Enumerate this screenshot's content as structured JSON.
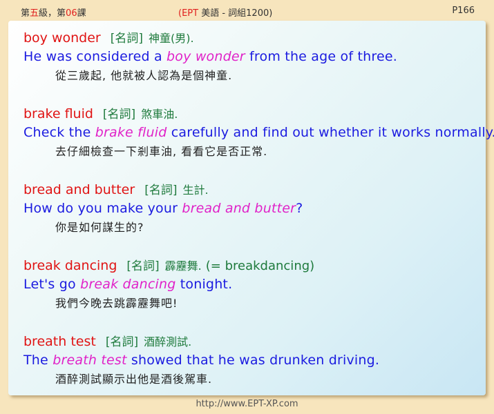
{
  "header": {
    "left_prefix": "第",
    "left_grade": "五",
    "left_mid": "級，第",
    "left_lesson": "06",
    "left_suffix": "課",
    "center_open": "(",
    "center_ept": "EPT",
    "center_rest": " 美語 - 詞組1200)",
    "page": "P166"
  },
  "entries": [
    {
      "term": "boy wonder",
      "pos": "[名詞]",
      "meaning": "神童(男).",
      "note": "",
      "sentence_before": "He was considered a ",
      "sentence_highlight": "boy wonder",
      "sentence_after": " from the age of three.",
      "translation": "從三歲起, 他就被人認為是個神童."
    },
    {
      "term": "brake fluid",
      "pos": "[名詞]",
      "meaning": "煞車油.",
      "note": "",
      "sentence_before": "Check the ",
      "sentence_highlight": "brake fluid",
      "sentence_after": " carefully and find out whether it works normally.",
      "translation": "去仔細檢查一下剎車油, 看看它是否正常."
    },
    {
      "term": "bread and butter",
      "pos": "[名詞]",
      "meaning": "生計.",
      "note": "",
      "sentence_before": "How do you make your ",
      "sentence_highlight": "bread and butter",
      "sentence_after": "?",
      "translation": "你是如何謀生的?"
    },
    {
      "term": "break dancing",
      "pos": "[名詞]",
      "meaning": "霹靂舞.",
      "note": "(= breakdancing)",
      "sentence_before": "Let's go ",
      "sentence_highlight": "break dancing",
      "sentence_after": " tonight.",
      "translation": "我們今晚去跳霹靂舞吧!"
    },
    {
      "term": "breath test",
      "pos": "[名詞]",
      "meaning": "酒醉測試.",
      "note": "",
      "sentence_before": "The ",
      "sentence_highlight": "breath test",
      "sentence_after": " showed that he was drunken driving.",
      "translation": "酒醉測試顯示出他是酒後駕車."
    }
  ],
  "footer": {
    "url": "http://www.EPT-XP.com"
  },
  "colors": {
    "term": "#e01414",
    "pos": "#1e7a3c",
    "sentence": "#1b1be0",
    "highlight": "#e022c8",
    "page_bg": "#f7e5bd"
  }
}
